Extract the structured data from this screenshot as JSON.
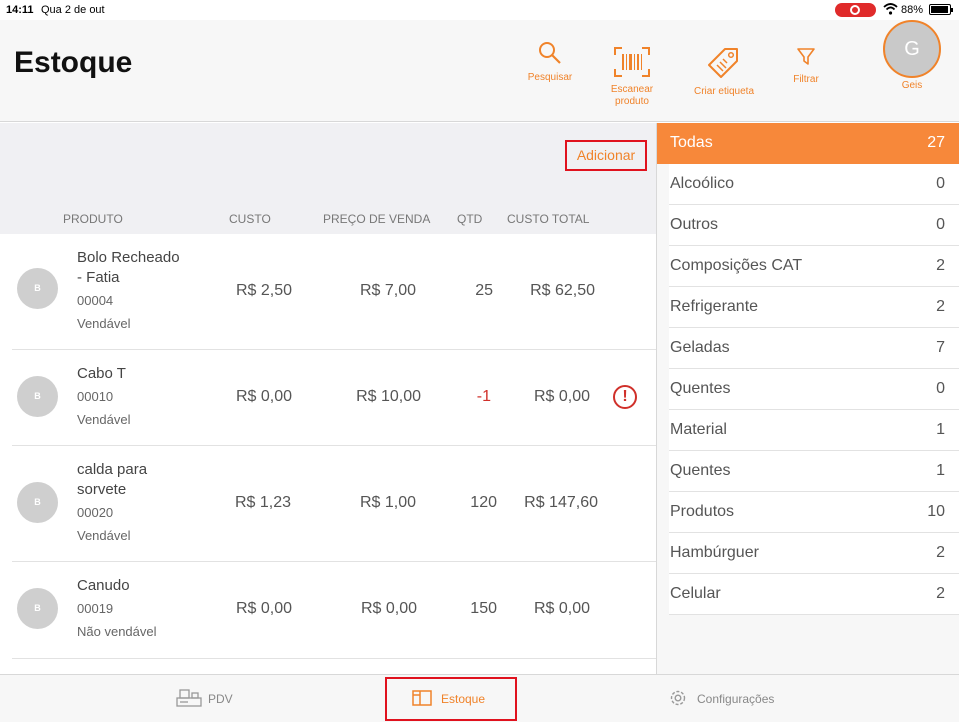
{
  "status_bar": {
    "time": "14:11",
    "date": "Qua 2 de out",
    "battery": "88%"
  },
  "header": {
    "title": "Estoque",
    "actions": {
      "search": "Pesquisar",
      "scan_line1": "Escanear",
      "scan_line2": "produto",
      "label": "Criar etiqueta",
      "filter": "Filtrar"
    },
    "user": {
      "initial": "G",
      "name": "Geis"
    }
  },
  "toolbar": {
    "add_label": "Adicionar"
  },
  "columns": {
    "product": "PRODUTO",
    "cost": "CUSTO",
    "price": "PREÇO DE VENDA",
    "qty": "QTD",
    "total": "CUSTO TOTAL"
  },
  "products": [
    {
      "thumb": "B",
      "name_line1": "Bolo Recheado",
      "name_line2": "- Fatia",
      "code": "00004",
      "status": "Vendável",
      "cost": "R$ 2,50",
      "price": "R$ 7,00",
      "qty": "25",
      "total": "R$ 62,50"
    },
    {
      "thumb": "B",
      "name_line1": "Cabo T",
      "name_line2": "",
      "code": "00010",
      "status": "Vendável",
      "cost": "R$ 0,00",
      "price": "R$ 10,00",
      "qty": "-1",
      "total": "R$ 0,00",
      "warning": "!"
    },
    {
      "thumb": "B",
      "name_line1": "calda para",
      "name_line2": "sorvete",
      "code": "00020",
      "status": "Vendável",
      "cost": "R$ 1,23",
      "price": "R$ 1,00",
      "qty": "120",
      "total": "R$ 147,60"
    },
    {
      "thumb": "B",
      "name_line1": "Canudo",
      "name_line2": "",
      "code": "00019",
      "status": "Não vendável",
      "cost": "R$ 0,00",
      "price": "R$ 0,00",
      "qty": "150",
      "total": "R$ 0,00"
    }
  ],
  "categories": [
    {
      "name": "Todas",
      "count": "27"
    },
    {
      "name": "Alcoólico",
      "count": "0"
    },
    {
      "name": "Outros",
      "count": "0"
    },
    {
      "name": "Composições CAT",
      "count": "2"
    },
    {
      "name": "Refrigerante",
      "count": "2"
    },
    {
      "name": "Geladas",
      "count": "7"
    },
    {
      "name": "Quentes",
      "count": "0"
    },
    {
      "name": "Material",
      "count": "1"
    },
    {
      "name": "Quentes",
      "count": "1"
    },
    {
      "name": "Produtos",
      "count": "10"
    },
    {
      "name": "Hambúrguer",
      "count": "2"
    },
    {
      "name": "Celular",
      "count": "2"
    }
  ],
  "tabs": {
    "pdv": "PDV",
    "stock": "Estoque",
    "settings": "Configurações"
  },
  "colors": {
    "accent": "#f0832a",
    "active_category": "#f7883a",
    "highlight": "#e0121e",
    "negative": "#d0302a"
  },
  "icons": [
    "search-icon",
    "barcode-icon",
    "tag-icon",
    "filter-icon",
    "register-icon",
    "box-icon",
    "gear-icon",
    "warning-icon"
  ]
}
